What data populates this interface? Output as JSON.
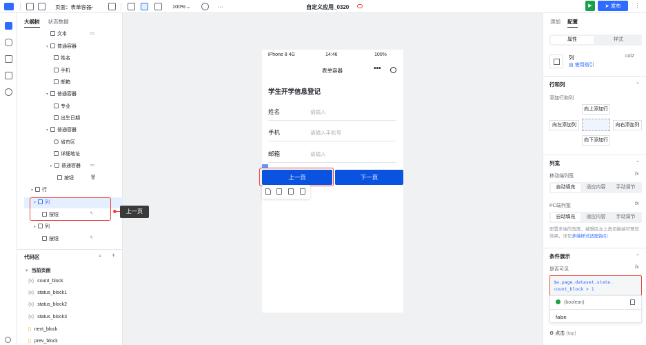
{
  "topbar": {
    "page_label": "页面：表单容器",
    "zoom": "100%",
    "app_title": "自定义应用_0320",
    "publish_label": "发布",
    "more": "···"
  },
  "outline": {
    "tab_outline": "大纲树",
    "tab_state": "状态数据",
    "rows": [
      {
        "label": "文本"
      },
      {
        "label": "普通容器"
      },
      {
        "label": "姓名"
      },
      {
        "label": "手机"
      },
      {
        "label": "邮箱"
      },
      {
        "label": "普通容器"
      },
      {
        "label": "专业"
      },
      {
        "label": "出生日期"
      },
      {
        "label": "普通容器"
      },
      {
        "label": "省市区"
      },
      {
        "label": "详细地址"
      },
      {
        "label": "普通容器"
      },
      {
        "label": "按钮"
      },
      {
        "label": "行"
      },
      {
        "label": "列"
      },
      {
        "label": "按钮"
      },
      {
        "label": "列"
      },
      {
        "label": "按钮"
      }
    ]
  },
  "code": {
    "title": "代码区",
    "group": "当前页面",
    "items": [
      {
        "name": "count_block"
      },
      {
        "name": "status_block1"
      },
      {
        "name": "status_block2"
      },
      {
        "name": "status_block3"
      },
      {
        "name": "next_block"
      },
      {
        "name": "prev_block"
      }
    ]
  },
  "phone": {
    "carrier": "iPhone 8  4G",
    "time": "14:46",
    "battery": "100%",
    "nav_title": "表单容器",
    "nav_more": "•••",
    "form_title": "学生开学信息登记",
    "fields": [
      {
        "label": "姓名",
        "placeholder": "请输入"
      },
      {
        "label": "手机",
        "placeholder": "请输入手机号"
      },
      {
        "label": "邮箱",
        "placeholder": "请输入"
      }
    ],
    "prev_label": "上一页",
    "next_label": "下一页"
  },
  "tooltip": "上一页",
  "config": {
    "tab_add": "添加",
    "tab_config": "配置",
    "seg_props": "属性",
    "seg_style": "样式",
    "component_name": "列",
    "component_id": "col2",
    "guide": "使用指引",
    "section_rowcol": "行和列",
    "add_rowcol": "添加行和列",
    "add_up": "向上添加行",
    "add_left": "向左添加列",
    "add_right": "向右添加列",
    "add_down": "向下添加行",
    "section_width": "列宽",
    "mobile_width": "移动端列宽",
    "pc_width": "PC端列宽",
    "opt_auto": "自动填充",
    "opt_fit": "适应内容",
    "opt_manual": "手动调节",
    "hint_text": "配置多端的宽度，编辑区左上角切换端可预览效果，详见",
    "hint_link": "多端样式适配指引",
    "section_cond": "条件展示",
    "visible_label": "是否可见",
    "expr_line1": "$w.page.dataset.state.",
    "expr_line2": "count_block > 1",
    "result_type": "(boolean)",
    "result_value": "false",
    "tap_label": "点击",
    "tap_hint": "(tap)",
    "fx": "fx"
  }
}
